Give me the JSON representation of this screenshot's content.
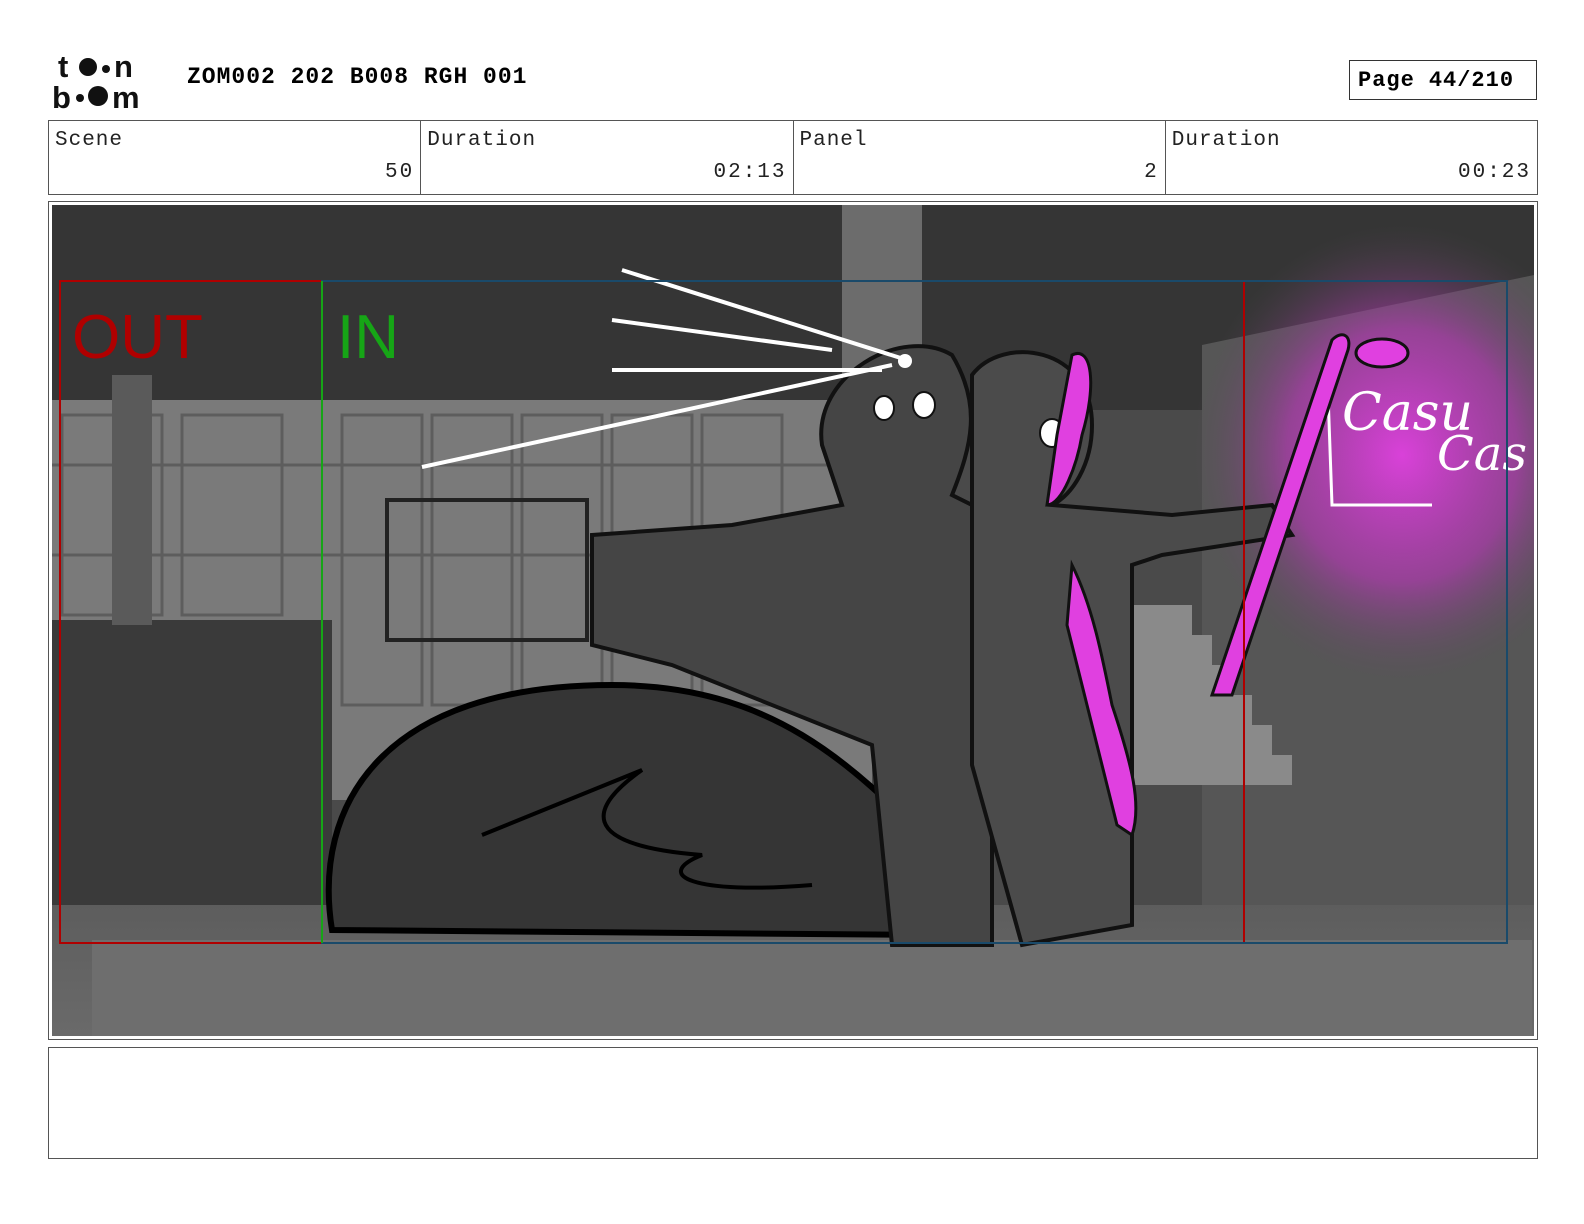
{
  "header": {
    "logo_text_top": "toon",
    "logo_text_bottom": "boom",
    "title": "ZOM002 202 B008 RGH 001",
    "page_label": "Page",
    "page_value": "44/210"
  },
  "info": {
    "scene_label": "Scene",
    "scene_value": "50",
    "scene_duration_label": "Duration",
    "scene_duration_value": "02:13",
    "panel_label": "Panel",
    "panel_value": "2",
    "panel_duration_label": "Duration",
    "panel_duration_value": "00:23"
  },
  "panel": {
    "out_label": "OUT",
    "in_label": "IN",
    "sign_line1": "Casu",
    "sign_line2": "Cas",
    "colors": {
      "out_frame": "#b00000",
      "in_frame": "#16a516",
      "highlight": "#e040e0",
      "frame_blue": "#1a4a6a"
    }
  },
  "notes": {
    "text": ""
  }
}
